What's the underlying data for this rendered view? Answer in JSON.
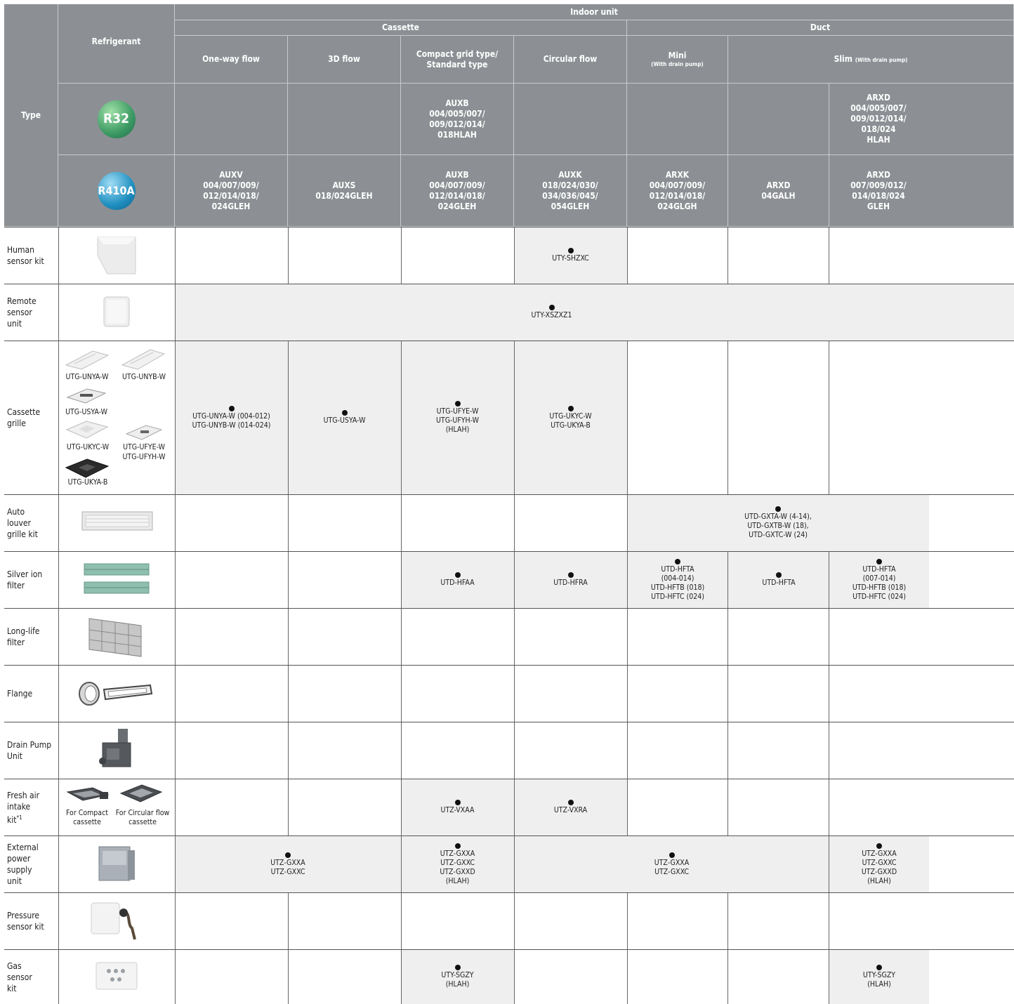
{
  "header": {
    "type_label": "Type",
    "refrigerant_label": "Refrigerant",
    "indoor_unit": "Indoor unit",
    "cassette": "Cassette",
    "duct": "Duct",
    "col_oneway": "One-way flow",
    "col_3d": "3D flow",
    "col_compact_1": "Compact grid type/",
    "col_compact_2": "Standard type",
    "col_circular": "Circular flow",
    "col_mini": "Mini",
    "col_mini_sub": "(With drain pump)",
    "col_slim": "Slim",
    "col_slim_sub": "(With drain pump)",
    "badge_r32": "R32",
    "badge_r410a": "R410A",
    "badge_r32_color": "#3c9a63",
    "badge_r410a_color": "#1f8fc0"
  },
  "r32_models": {
    "compact": [
      "AUXB",
      "004/005/007/",
      "009/012/014/",
      "018HLAH"
    ],
    "slim2": [
      "ARXD",
      "004/005/007/",
      "009/012/014/",
      "018/024",
      "HLAH"
    ]
  },
  "r410a_models": {
    "oneway": [
      "AUXV",
      "004/007/009/",
      "012/014/018/",
      "024GLEH"
    ],
    "d3": [
      "AUXS",
      "018/024GLEH"
    ],
    "compact": [
      "AUXB",
      "004/007/009/",
      "012/014/018/",
      "024GLEH"
    ],
    "circular": [
      "AUXK",
      "018/024/030/",
      "034/036/045/",
      "054GLEH"
    ],
    "mini": [
      "ARXK",
      "004/007/009/",
      "012/014/018/",
      "024GLGH"
    ],
    "slim1": [
      "ARXD",
      "04GALH"
    ],
    "slim2": [
      "ARXD",
      "007/009/012/",
      "014/018/024",
      "GLEH"
    ]
  },
  "rows": {
    "human": {
      "label": "Human sensor kit",
      "circular": [
        "UTY-SHZXC"
      ]
    },
    "remote": {
      "label": "Remote sensor unit",
      "all": [
        "UTY-XSZXZ1"
      ]
    },
    "grille": {
      "label": "Cassette grille",
      "img_labels": [
        "UTG-UNYA-W",
        "UTG-UNYB-W",
        "UTG-USYA-W",
        "UTG-UKYC-W",
        "UTG-UFYE-W",
        "UTG-UFYH-W",
        "UTG-UKYA-B"
      ],
      "oneway": [
        "UTG-UNYA-W (004-012)",
        "UTG-UNYB-W (014-024)"
      ],
      "d3": [
        "UTG-USYA-W"
      ],
      "compact": [
        "UTG-UFYE-W",
        "UTG-UFYH-W",
        "(HLAH)"
      ],
      "circular": [
        "UTG-UKYC-W",
        "UTG-UKYA-B"
      ]
    },
    "louver": {
      "label": "Auto louver grille kit",
      "duct": [
        "UTD-GXTA-W (4-14),",
        "UTD-GXTB-W (18),",
        "UTD-GXTC-W (24)"
      ]
    },
    "silver": {
      "label": "Silver ion filter",
      "compact": [
        "UTD-HFAA"
      ],
      "circular": [
        "UTD-HFRA"
      ],
      "mini": [
        "UTD-HFTA",
        "(004-014)",
        "UTD-HFTB (018)",
        "UTD-HFTC (024)"
      ],
      "slim1": [
        "UTD-HFTA"
      ],
      "slim2": [
        "UTD-HFTA",
        "(007-014)",
        "UTD-HFTB (018)",
        "UTD-HFTC (024)"
      ]
    },
    "longlife": {
      "label": "Long-life filter"
    },
    "flange": {
      "label": "Flange"
    },
    "drain": {
      "label": "Drain Pump Unit"
    },
    "fresh": {
      "label": "Fresh air intake kit",
      "label_sup": "*1",
      "img_caption_1": "For Compact cassette",
      "img_caption_2": "For Circular flow cassette",
      "compact": [
        "UTZ-VXAA"
      ],
      "circular": [
        "UTZ-VXRA"
      ]
    },
    "external": {
      "label": "External power supply unit",
      "left": [
        "UTZ-GXXA",
        "UTZ-GXXC"
      ],
      "compact": [
        "UTZ-GXXA",
        "UTZ-GXXC",
        "UTZ-GXXD",
        "(HLAH)"
      ],
      "mid": [
        "UTZ-GXXA",
        "UTZ-GXXC"
      ],
      "slim2": [
        "UTZ-GXXA",
        "UTZ-GXXC",
        "UTZ-GXXD",
        "(HLAH)"
      ]
    },
    "pressure": {
      "label": "Pressure sensor kit"
    },
    "gas": {
      "label": "Gas sensor kit",
      "compact": [
        "UTY-SGZY",
        "(HLAH)"
      ],
      "slim2": [
        "UTY-SGZY",
        "(HLAH)"
      ]
    }
  }
}
